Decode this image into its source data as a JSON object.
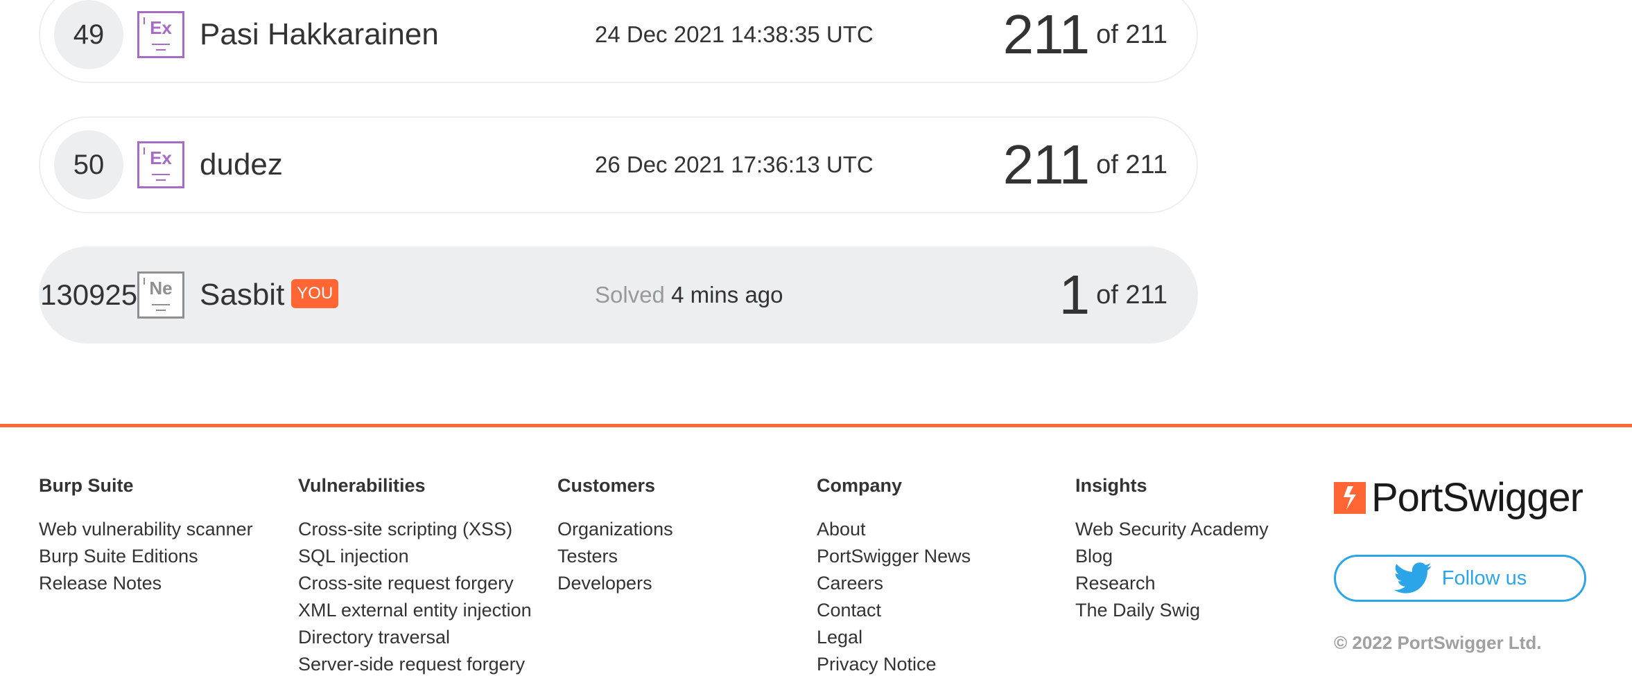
{
  "leaderboard": {
    "rows": [
      {
        "rank": "49",
        "badge": "Ex",
        "name": "Pasi Hakkarainen",
        "solved_at": "24 Dec 2021 14:38:35 UTC",
        "score": "211",
        "total": "of 211"
      },
      {
        "rank": "50",
        "badge": "Ex",
        "name": "dudez",
        "solved_at": "26 Dec 2021 17:36:13 UTC",
        "score": "211",
        "total": "of 211"
      }
    ],
    "you": {
      "rank": "130925",
      "badge": "Ne",
      "name": "Sasbit",
      "tag": "YOU",
      "solved_prefix": "Solved",
      "solved_ago": "4 mins ago",
      "score": "1",
      "total": "of 211"
    }
  },
  "footer": {
    "columns": [
      {
        "heading": "Burp Suite",
        "links": [
          "Web vulnerability scanner",
          "Burp Suite Editions",
          "Release Notes"
        ]
      },
      {
        "heading": "Vulnerabilities",
        "links": [
          "Cross-site scripting (XSS)",
          "SQL injection",
          "Cross-site request forgery",
          "XML external entity injection",
          "Directory traversal",
          "Server-side request forgery"
        ]
      },
      {
        "heading": "Customers",
        "links": [
          "Organizations",
          "Testers",
          "Developers"
        ]
      },
      {
        "heading": "Company",
        "links": [
          "About",
          "PortSwigger News",
          "Careers",
          "Contact",
          "Legal",
          "Privacy Notice"
        ]
      },
      {
        "heading": "Insights",
        "links": [
          "Web Security Academy",
          "Blog",
          "Research",
          "The Daily Swig"
        ]
      }
    ],
    "brand": "PortSwigger",
    "follow_label": "Follow us",
    "copyright": "© 2022 PortSwigger Ltd."
  },
  "colors": {
    "accent": "#ff6633",
    "expert_badge": "#a66bc4",
    "twitter": "#2ba4e8"
  },
  "icons": {
    "follow": "twitter-bird-icon",
    "brand": "portswigger-logo-icon"
  }
}
